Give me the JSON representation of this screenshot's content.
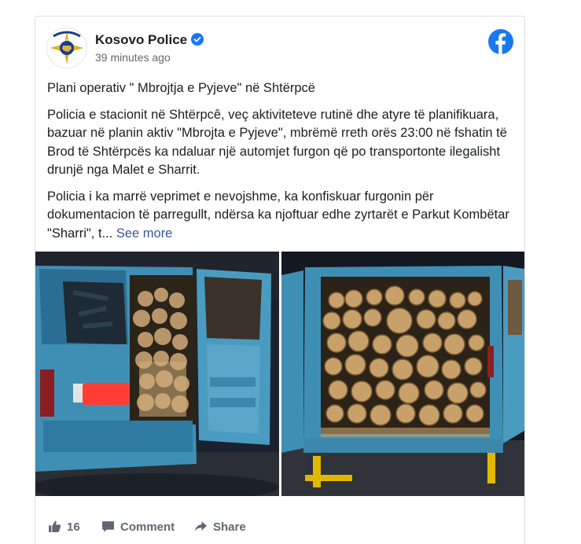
{
  "post": {
    "author": "Kosovo Police",
    "timestamp": "39 minutes ago",
    "verified_icon": "verified-badge-icon",
    "platform_icon": "facebook-logo-icon",
    "title": "Plani operativ \" Mbrojtja e Pyjeve\" në Shtërpcë",
    "paragraph1": "Policia e stacionit në Shtërpcê, veç aktiviteteve rutinë dhe atyre të planifikuara, bazuar në planin aktiv \"Mbrojta e Pyjeve\", mbrëmë rreth orës 23:00 në fshatin të Brod të Shtërpcës ka ndaluar një automjet furgon që po transportonte ilegalisht drunjë nga Malet e Sharrit.",
    "paragraph2": "Policia i ka marrë veprimet e nevojshme, ka konfiskuar furgonin për dokumentacion të parregullt, ndërsa ka njoftuar edhe zyrtarët e Parkut Kombëtar \"Sharri\", t...",
    "see_more": "See more"
  },
  "actions": {
    "like_count": "16",
    "comment_label": "Comment",
    "share_label": "Share"
  },
  "colors": {
    "facebook_blue": "#1877f2",
    "link_blue": "#385898",
    "van_blue": "#3f8fb5",
    "wood": "#c8a06a"
  }
}
